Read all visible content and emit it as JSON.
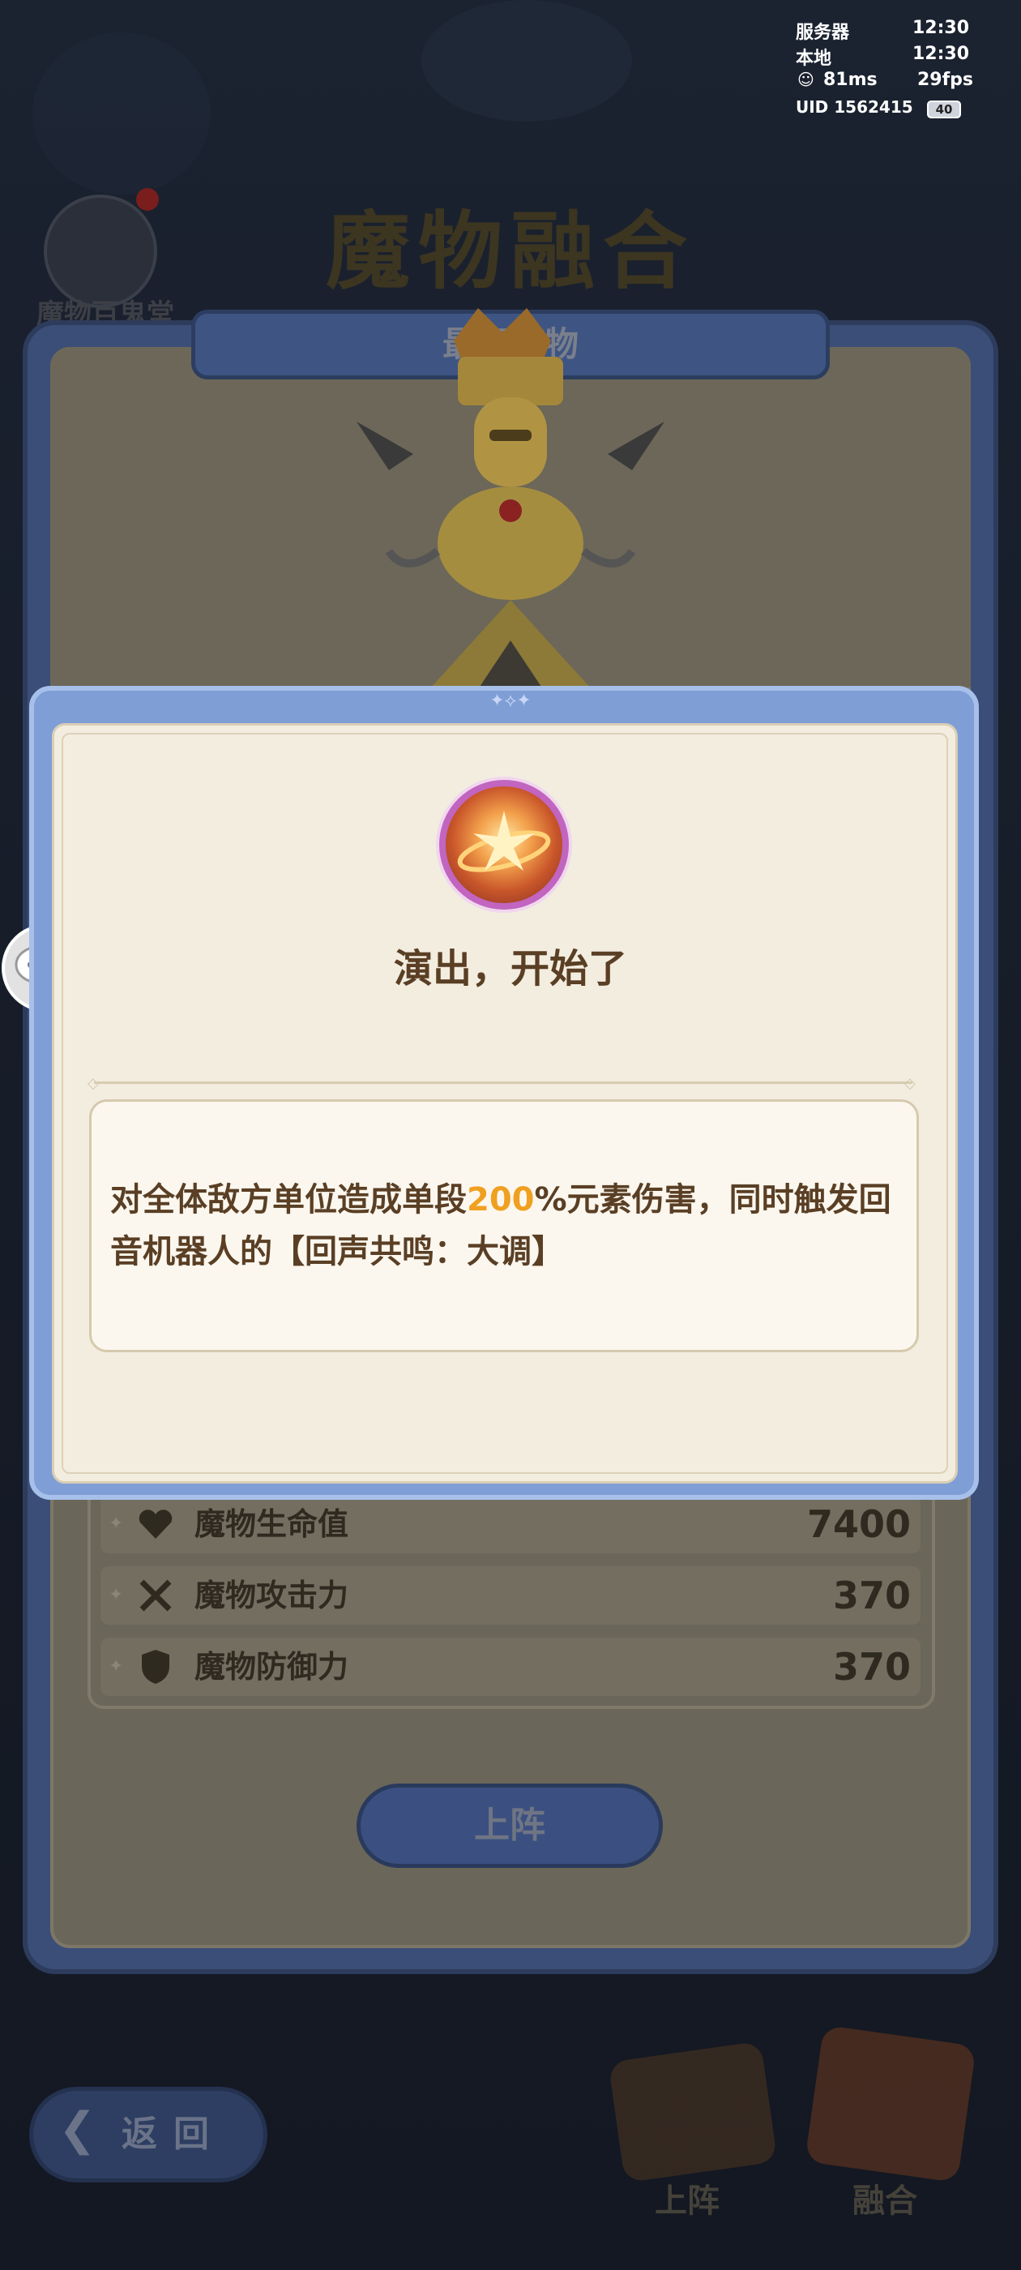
{
  "hud": {
    "server_label": "服务器",
    "server_time": "12:30",
    "local_label": "本地",
    "local_time": "12:30",
    "ping": "81ms",
    "fps": "29fps",
    "uid": "UID 1562415",
    "battery": "40"
  },
  "background": {
    "page_title": "魔物融合",
    "top_left_label": "魔物百鬼堂",
    "panel_title": "最强魔物"
  },
  "stats": [
    {
      "icon": "heart-icon",
      "label": "魔物生命值",
      "value": "7400"
    },
    {
      "icon": "swords-icon",
      "label": "魔物攻击力",
      "value": "370"
    },
    {
      "icon": "shield-icon",
      "label": "魔物防御力",
      "value": "370"
    }
  ],
  "actions": {
    "deploy_label": "上阵",
    "back_label": "返回",
    "nav_deploy": "上阵",
    "nav_fusion": "融合"
  },
  "skill_modal": {
    "title": "演出，开始了",
    "desc_part1": "对全体敌方单位造成单段",
    "desc_highlight": "200",
    "desc_part2": "%元素伤害，同时触发回音机器人的【回声共鸣：大调】",
    "highlight_color": "#f0a020"
  }
}
